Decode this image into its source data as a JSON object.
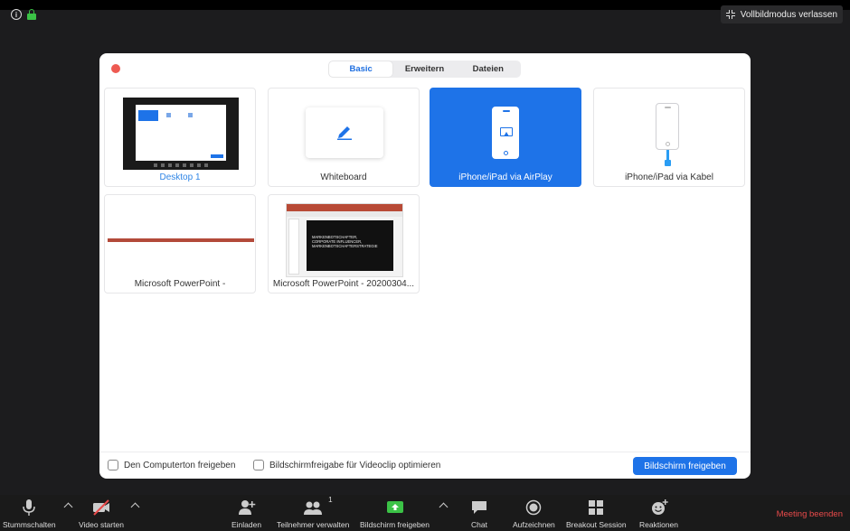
{
  "topbar": {
    "info_icon": "info-icon",
    "lock_icon": "lock-icon",
    "exit_fullscreen_label": "Vollbildmodus verlassen"
  },
  "dialog": {
    "tabs": [
      {
        "label": "Basic",
        "active": true
      },
      {
        "label": "Erweitern",
        "active": false
      },
      {
        "label": "Dateien",
        "active": false
      }
    ],
    "tiles": [
      {
        "caption": "Desktop 1",
        "selected": false
      },
      {
        "caption": "Whiteboard",
        "selected": false
      },
      {
        "caption": "iPhone/iPad via AirPlay",
        "selected": true
      },
      {
        "caption": "iPhone/iPad via Kabel",
        "selected": false
      },
      {
        "caption": "Microsoft PowerPoint -",
        "selected": false
      },
      {
        "caption": "Microsoft PowerPoint - 20200304...",
        "selected": false
      }
    ],
    "ppt_slide": {
      "line1": "MARKENBOTSCHAFTER,",
      "line2": "CORPORATE INFLUENCER,",
      "line3": "MARKENBOTSCHAFTERSTRATEGIE"
    },
    "footer": {
      "computer_audio_label": "Den Computerton freigeben",
      "optimize_video_label": "Bildschirmfreigabe für Videoclip optimieren",
      "share_button_label": "Bildschirm freigeben"
    }
  },
  "toolbar": {
    "items": [
      {
        "label": "Stummschalten",
        "icon": "microphone-icon"
      },
      {
        "label": "Video starten",
        "icon": "video-off-icon"
      },
      {
        "label": "Einladen",
        "icon": "add-user-icon"
      },
      {
        "label": "Teilnehmer verwalten",
        "icon": "participants-icon",
        "count": "1"
      },
      {
        "label": "Bildschirm freigeben",
        "icon": "share-screen-icon"
      },
      {
        "label": "Chat",
        "icon": "chat-icon"
      },
      {
        "label": "Aufzeichnen",
        "icon": "record-icon"
      },
      {
        "label": "Breakout Session",
        "icon": "breakout-icon"
      },
      {
        "label": "Reaktionen",
        "icon": "reactions-icon"
      }
    ],
    "end_meeting_label": "Meeting beenden",
    "colors": {
      "share_green": "#3bc246",
      "end_red": "#e84a4a",
      "accent_blue": "#1e73e8"
    }
  }
}
